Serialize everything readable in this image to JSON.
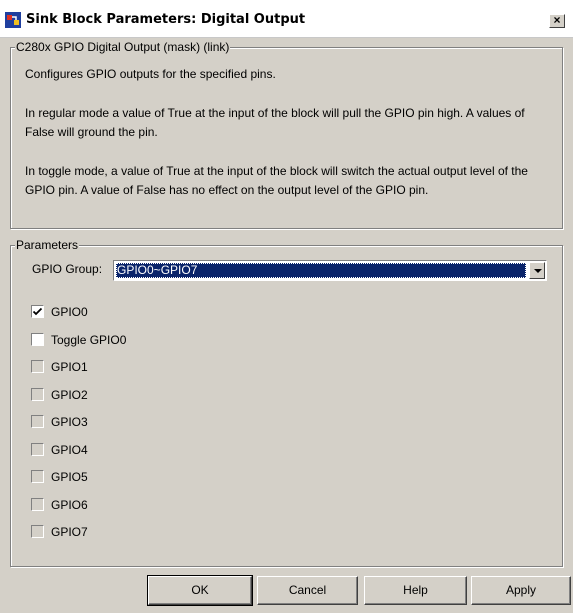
{
  "window": {
    "title": "Sink Block Parameters: Digital Output",
    "close_label": "×"
  },
  "description": {
    "legend": "C280x GPIO Digital Output (mask) (link)",
    "paragraphs": [
      "Configures GPIO outputs for the specified pins.",
      "In regular mode a value of True at the input of the block will pull the GPIO pin high. A values of False will ground the pin.",
      "In toggle mode, a value of True at the input of the block will switch the actual output level of the GPIO pin. A value of False has no effect on the output level of the GPIO pin."
    ]
  },
  "parameters": {
    "legend": "Parameters",
    "gpio_group_label": "GPIO Group:",
    "gpio_group_value": "GPIO0~GPIO7",
    "checkboxes": [
      {
        "label": "GPIO0",
        "checked": true,
        "enabled": true
      },
      {
        "label": "Toggle GPIO0",
        "checked": false,
        "enabled": true
      },
      {
        "label": "GPIO1",
        "checked": false,
        "enabled": false
      },
      {
        "label": "GPIO2",
        "checked": false,
        "enabled": false
      },
      {
        "label": "GPIO3",
        "checked": false,
        "enabled": false
      },
      {
        "label": "GPIO4",
        "checked": false,
        "enabled": false
      },
      {
        "label": "GPIO5",
        "checked": false,
        "enabled": false
      },
      {
        "label": "GPIO6",
        "checked": false,
        "enabled": false
      },
      {
        "label": "GPIO7",
        "checked": false,
        "enabled": false
      }
    ]
  },
  "buttons": {
    "ok": "OK",
    "cancel": "Cancel",
    "help": "Help",
    "apply": "Apply"
  },
  "colors": {
    "dialog_bg": "#d4d0c8",
    "selection": "#0a246a"
  }
}
